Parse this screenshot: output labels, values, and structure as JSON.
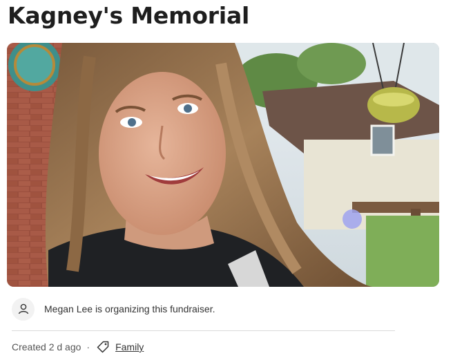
{
  "campaign": {
    "title": "Kagney's Memorial"
  },
  "hero_image": {
    "description_icon": "photo"
  },
  "organizer": {
    "icon": "user-icon",
    "text": "Megan Lee is organizing this fundraiser."
  },
  "meta": {
    "created": "Created 2 d ago",
    "separator": "·",
    "category_icon": "tag-icon",
    "category": "Family"
  }
}
